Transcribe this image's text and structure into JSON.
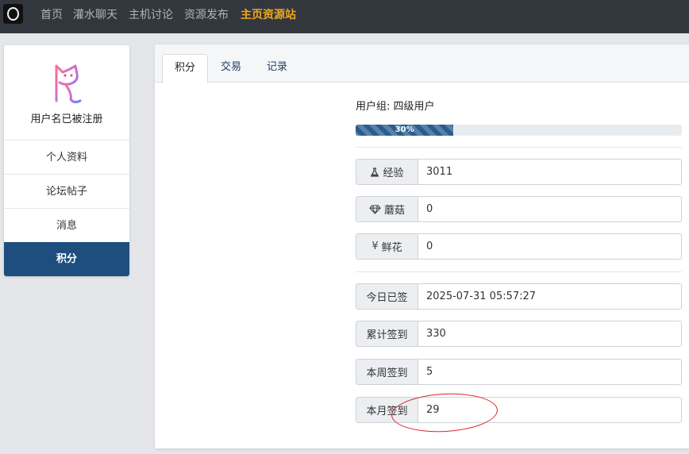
{
  "navbar": {
    "links": [
      "首页",
      "灌水聊天",
      "主机讨论",
      "资源发布",
      "主页资源站"
    ]
  },
  "sidebar": {
    "username": "用户名已被注册",
    "items": [
      "个人资料",
      "论坛帖子",
      "消息",
      "积分"
    ]
  },
  "tabs": [
    "积分",
    "交易",
    "记录"
  ],
  "user_group": "用户组: 四级用户",
  "progress": {
    "percent": 30,
    "label": "30%"
  },
  "stats": [
    {
      "icon": "flask-icon",
      "label": "经验",
      "value": "3011"
    },
    {
      "icon": "diamond-icon",
      "label": "蘑菇",
      "value": "0"
    },
    {
      "icon": "yen-icon",
      "label": "鲜花",
      "value": "0"
    }
  ],
  "checkin": [
    {
      "label": "今日已签",
      "value": "2025-07-31 05:57:27"
    },
    {
      "label": "累计签到",
      "value": "330"
    },
    {
      "label": "本周签到",
      "value": "5"
    },
    {
      "label": "本月签到",
      "value": "29"
    }
  ],
  "colors": {
    "nav_bg": "#32373d",
    "nav_active": "#f0a71b",
    "sidebar_active": "#1d4e7e",
    "progress": "#2a5d8e",
    "annotation": "#d8252b"
  }
}
